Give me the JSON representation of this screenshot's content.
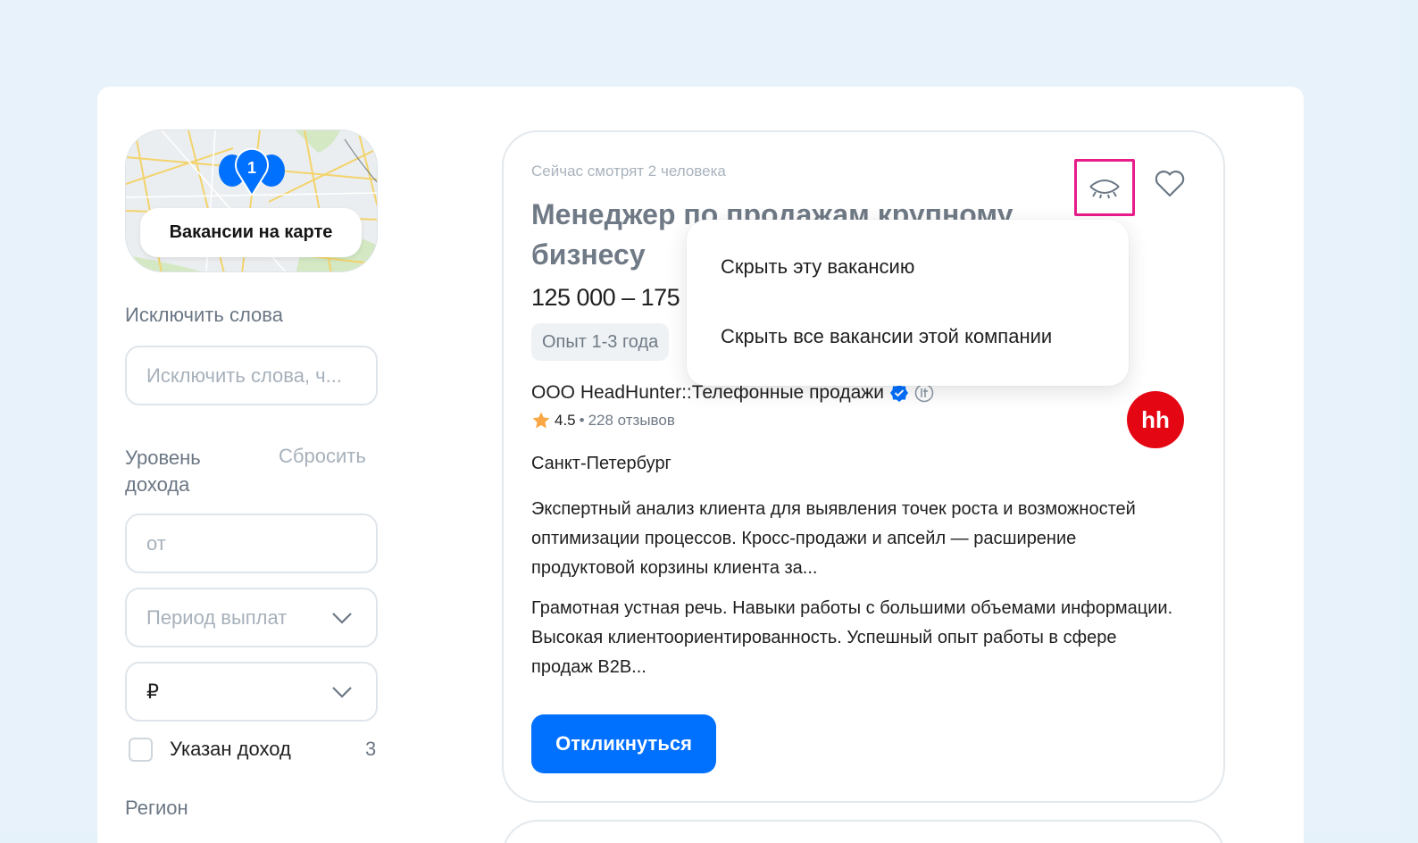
{
  "sidebar": {
    "map_button": "Вакансии на карте",
    "map_pin_count": "1",
    "exclude_words_label": "Исключить слова",
    "exclude_words_placeholder": "Исключить слова, ч...",
    "income_label_line1": "Уровень",
    "income_label_line2": "дохода",
    "reset_label": "Сбросить",
    "income_from_placeholder": "от",
    "payment_period_placeholder": "Период выплат",
    "currency_value": "₽",
    "income_specified_label": "Указан доход",
    "income_specified_count": "3",
    "region_label": "Регион"
  },
  "vacancy": {
    "viewers": "Сейчас смотрят 2 человека",
    "title_line1": "Менеджер по продажам крупному",
    "title_line2": "бизнесу",
    "salary": "125 000 – 175 (",
    "experience": "Опыт 1-3 года",
    "company": "ООО HeadHunter::Телефонные продажи",
    "rating": "4.5",
    "reviews": "228 отзывов",
    "city": "Санкт-Петербург",
    "description1": "Экспертный анализ клиента для выявления точек роста и возможностей оптимизации процессов. Кросс-продажи и апсейл — расширение продуктовой корзины клиента за...",
    "description2": "Грамотная устная речь. Навыки работы с большими объемами информации. Высокая клиентоориентированность. Успешный опыт работы в сфере продаж B2B...",
    "apply_button": "Откликнуться",
    "logo_text": "hh"
  },
  "hide_menu": {
    "item1": "Скрыть эту вакансию",
    "item2": "Скрыть все вакансии этой компании"
  },
  "colors": {
    "accent_blue": "#0070ff",
    "highlight_pink": "#e81c8a",
    "hh_red": "#e40613"
  },
  "icons": {
    "hide": "eye-closed-icon",
    "favorite": "heart-icon",
    "verified": "verified-badge-icon",
    "it_accredited": "it-accreditation-icon",
    "star": "star-icon",
    "chevron": "chevron-down-icon"
  }
}
